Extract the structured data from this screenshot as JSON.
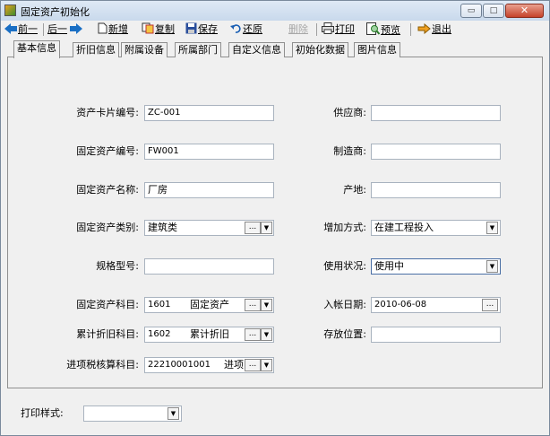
{
  "window": {
    "title": "固定资产初始化",
    "close_glyph": "✕",
    "min_glyph": "▭",
    "max_glyph": "□"
  },
  "toolbar": {
    "prev": "前一",
    "next": "后一",
    "new": "新增",
    "copy": "复制",
    "save": "保存",
    "restore": "还原",
    "delete": "删除",
    "print": "打印",
    "preview": "预览",
    "exit": "退出"
  },
  "tabs": [
    "基本信息",
    "折旧信息",
    "附属设备",
    "所属部门",
    "自定义信息",
    "初始化数据",
    "图片信息"
  ],
  "form": {
    "card_no": {
      "label": "资产卡片编号:",
      "value": "ZC-001"
    },
    "asset_no": {
      "label": "固定资产编号:",
      "value": "FW001"
    },
    "asset_name": {
      "label": "固定资产名称:",
      "value": "厂房"
    },
    "asset_category": {
      "label": "固定资产类别:",
      "value": "建筑类"
    },
    "spec_model": {
      "label": "规格型号:",
      "value": ""
    },
    "asset_account": {
      "label": "固定资产科目:",
      "value": "1601",
      "desc": "固定资产"
    },
    "depr_account": {
      "label": "累计折旧科目:",
      "value": "1602",
      "desc": "累计折旧"
    },
    "input_tax_account": {
      "label": "进项税核算科目:",
      "value": "22210001001",
      "desc": "进项"
    },
    "supplier": {
      "label": "供应商:",
      "value": ""
    },
    "manufacturer": {
      "label": "制造商:",
      "value": ""
    },
    "origin": {
      "label": "产地:",
      "value": ""
    },
    "add_method": {
      "label": "增加方式:",
      "value": "在建工程投入"
    },
    "usage_status": {
      "label": "使用状况:",
      "value": "使用中"
    },
    "entry_date": {
      "label": "入帐日期:",
      "value": "2010-06-08"
    },
    "location": {
      "label": "存放位置:",
      "value": ""
    }
  },
  "print_style": {
    "label": "打印样式:",
    "value": ""
  },
  "glyphs": {
    "dd": "▼",
    "dots": "...",
    "ellipsis_btn": "..."
  }
}
